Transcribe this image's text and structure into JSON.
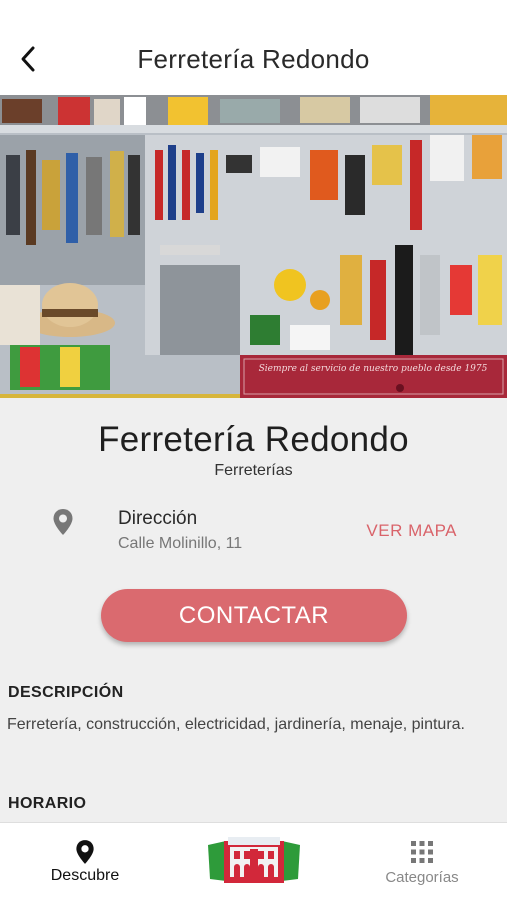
{
  "header": {
    "back_icon": "chevron-left-icon",
    "title": "Ferretería Redondo"
  },
  "hero": {
    "banner_text": "Siempre al servicio de nuestro pueblo desde 1975"
  },
  "business": {
    "name": "Ferretería Redondo",
    "category": "Ferreterías"
  },
  "address": {
    "icon": "location-pin-icon",
    "label": "Dirección",
    "value": "Calle Molinillo,  11",
    "map_link": "VER MAPA"
  },
  "contact_button": "CONTACTAR",
  "description": {
    "title": "DESCRIPCIÓN",
    "text": "Ferretería, construcción, electricidad, jardinería, menaje, pintura."
  },
  "hours": {
    "title": "HORARIO"
  },
  "tabs": [
    {
      "label": "Descubre",
      "icon": "location-pin-icon",
      "active": true
    },
    {
      "label": "",
      "icon": "town-hall-logo-icon",
      "active": false
    },
    {
      "label": "Categorías",
      "icon": "grid-icon",
      "active": false
    }
  ],
  "colors": {
    "accent": "#da6a6f",
    "map_link": "#d9636a",
    "background": "#efefef",
    "banner": "#a8283a"
  }
}
